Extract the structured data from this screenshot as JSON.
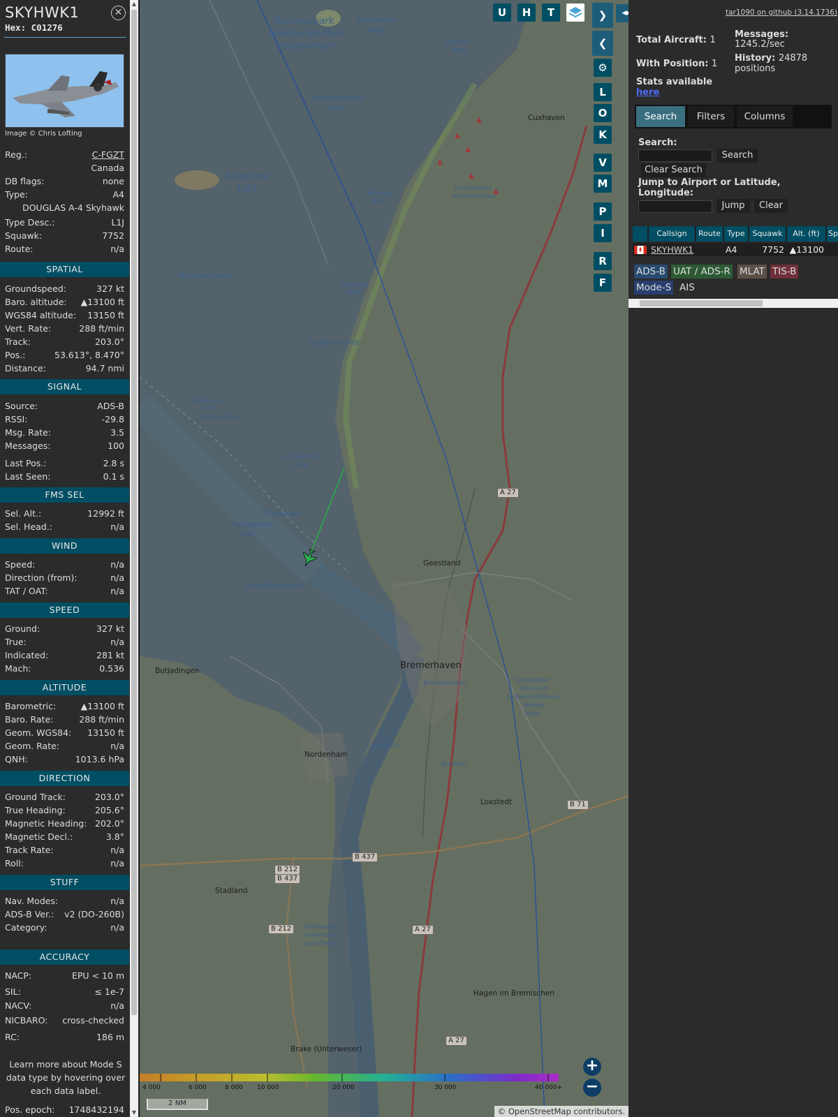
{
  "aircraft": {
    "callsign": "SKYHWK1",
    "hex_label": "Hex:",
    "hex": "C01276",
    "photo_credit": "Image © Chris Lofting",
    "reg_label": "Reg.:",
    "reg": "C-FGZT",
    "country": "Canada",
    "dbflags_label": "DB flags:",
    "dbflags": "none",
    "type_label": "Type:",
    "type": "A4",
    "type_full": "DOUGLAS A-4 Skyhawk",
    "typedesc_label": "Type Desc.:",
    "typedesc": "L1J",
    "squawk_label": "Squawk:",
    "squawk": "7752",
    "route_label": "Route:",
    "route": "n/a"
  },
  "sections": {
    "spatial": {
      "title": "SPATIAL",
      "rows": [
        {
          "k": "Groundspeed:",
          "v": "327 kt"
        },
        {
          "k": "Baro. altitude:",
          "v": "▲13100 ft"
        },
        {
          "k": "WGS84 altitude:",
          "v": "13150 ft"
        },
        {
          "k": "Vert. Rate:",
          "v": "288 ft/min"
        },
        {
          "k": "Track:",
          "v": "203.0°"
        },
        {
          "k": "Pos.:",
          "v": "53.613°, 8.470°"
        },
        {
          "k": "Distance:",
          "v": "94.7 nmi"
        }
      ]
    },
    "signal": {
      "title": "SIGNAL",
      "rows": [
        {
          "k": "Source:",
          "v": "ADS-B"
        },
        {
          "k": "RSSI:",
          "v": "-29.8"
        },
        {
          "k": "Msg. Rate:",
          "v": "3.5"
        },
        {
          "k": "Messages:",
          "v": "100"
        },
        {
          "k": "Last Pos.:",
          "v": "2.8 s"
        },
        {
          "k": "Last Seen:",
          "v": "0.1 s"
        }
      ]
    },
    "fms": {
      "title": "FMS SEL",
      "rows": [
        {
          "k": "Sel. Alt.:",
          "v": "12992 ft"
        },
        {
          "k": "Sel. Head.:",
          "v": "n/a"
        }
      ]
    },
    "wind": {
      "title": "WIND",
      "rows": [
        {
          "k": "Speed:",
          "v": "n/a"
        },
        {
          "k": "Direction (from):",
          "v": "n/a"
        },
        {
          "k": "TAT / OAT:",
          "v": "n/a"
        }
      ]
    },
    "speed": {
      "title": "SPEED",
      "rows": [
        {
          "k": "Ground:",
          "v": "327 kt"
        },
        {
          "k": "True:",
          "v": "n/a"
        },
        {
          "k": "Indicated:",
          "v": "281 kt"
        },
        {
          "k": "Mach:",
          "v": "0.536"
        }
      ]
    },
    "altitude": {
      "title": "ALTITUDE",
      "rows": [
        {
          "k": "Barometric:",
          "v": "▲13100 ft"
        },
        {
          "k": "Baro. Rate:",
          "v": "288 ft/min"
        },
        {
          "k": "Geom. WGS84:",
          "v": "13150 ft"
        },
        {
          "k": "Geom. Rate:",
          "v": "n/a"
        },
        {
          "k": "QNH:",
          "v": "1013.6 hPa"
        }
      ]
    },
    "direction": {
      "title": "DIRECTION",
      "rows": [
        {
          "k": "Ground Track:",
          "v": "203.0°"
        },
        {
          "k": "True Heading:",
          "v": "205.6°"
        },
        {
          "k": "Magnetic Heading:",
          "v": "202.0°"
        },
        {
          "k": "Magnetic Decl.:",
          "v": "3.8°"
        },
        {
          "k": "Track Rate:",
          "v": "n/a"
        },
        {
          "k": "Roll:",
          "v": "n/a"
        }
      ]
    },
    "stuff": {
      "title": "STUFF",
      "rows": [
        {
          "k": "Nav. Modes:",
          "v": "n/a"
        },
        {
          "k": "ADS-B Ver.:",
          "v": "v2 (DO-260B)"
        },
        {
          "k": "Category:",
          "v": "n/a"
        }
      ]
    },
    "accuracy": {
      "title": "ACCURACY",
      "rows": [
        {
          "k": "NACP:",
          "v": "EPU < 10 m"
        },
        {
          "k": "SIL:",
          "v": "≤ 1e-7"
        },
        {
          "k": "NACV:",
          "v": "n/a"
        },
        {
          "k": "NICBARO:",
          "v": "cross-checked"
        },
        {
          "k": "RC:",
          "v": "186 m"
        }
      ]
    }
  },
  "note": "Learn more about Mode S data type by hovering over each data label.",
  "epoch_label": "Pos. epoch:",
  "epoch": "1748432194",
  "map": {
    "buttons": [
      "U",
      "H",
      "T"
    ],
    "side_buttons": [
      "L",
      "O",
      "K",
      "V",
      "M",
      "P",
      "I",
      "R",
      "F"
    ],
    "labels": [
      {
        "t": "Nationalpark",
        "cls": "water"
      },
      {
        "t": "Hamburgisches",
        "cls": "water"
      },
      {
        "t": "Wattenmeer",
        "cls": "water"
      },
      {
        "t": "Neuwerker",
        "cls": "water"
      },
      {
        "t": "Watt",
        "cls": "water"
      },
      {
        "t": "Duhner",
        "cls": "water"
      },
      {
        "t": "Watt",
        "cls": "water"
      },
      {
        "t": "Sahlenburger",
        "cls": "water"
      },
      {
        "t": "Watt",
        "cls": "water"
      },
      {
        "t": "Ruhezone",
        "cls": "water"
      },
      {
        "t": "1/47",
        "cls": "water"
      },
      {
        "t": "Nordeversand",
        "cls": "water"
      },
      {
        "t": "Wurster",
        "cls": "water"
      },
      {
        "t": "Watt",
        "cls": "water"
      },
      {
        "t": "Wurster",
        "cls": "water"
      },
      {
        "t": "Watt",
        "cls": "water"
      },
      {
        "t": "Sudeversand",
        "cls": "water"
      },
      {
        "t": "Ruhezone",
        "cls": "water"
      },
      {
        "t": "1/46",
        "cls": "water"
      },
      {
        "t": "Robbenplate",
        "cls": "water"
      },
      {
        "t": "Ruhezone",
        "cls": "water"
      },
      {
        "t": "1/44",
        "cls": "water"
      },
      {
        "t": "Tideweser",
        "cls": "water"
      },
      {
        "t": "Ruhezone",
        "cls": "water"
      },
      {
        "t": "1/40",
        "cls": "water"
      },
      {
        "t": "Langlütjensand",
        "cls": "water"
      },
      {
        "t": "Cuxhaven",
        "cls": "town"
      },
      {
        "t": "Cuxhavener",
        "cls": "water"
      },
      {
        "t": "Küstenheiden",
        "cls": "water"
      },
      {
        "t": "Geestland",
        "cls": "town"
      },
      {
        "t": "Bremerhaven",
        "cls": "town"
      },
      {
        "t": "Bremerhaven",
        "cls": "water"
      },
      {
        "t": "Butjadingen",
        "cls": "town"
      },
      {
        "t": "Sellstedter",
        "cls": "water"
      },
      {
        "t": "See und",
        "cls": "water"
      },
      {
        "t": "Ochsentriftmoor/",
        "cls": "water"
      },
      {
        "t": "Wildes",
        "cls": "water"
      },
      {
        "t": "Moor",
        "cls": "water"
      },
      {
        "t": "Nordenham",
        "cls": "town"
      },
      {
        "t": "Luneplate",
        "cls": "water"
      },
      {
        "t": "Bremen",
        "cls": "water"
      },
      {
        "t": "Loxstedt",
        "cls": "town"
      },
      {
        "t": "Stadland",
        "cls": "town"
      },
      {
        "t": "Strohauser",
        "cls": "water"
      },
      {
        "t": "Vorländer",
        "cls": "water"
      },
      {
        "t": "und Plate",
        "cls": "water"
      },
      {
        "t": "Hagen im Bremischen",
        "cls": "town"
      },
      {
        "t": "Brake (Unterweser)",
        "cls": "town"
      }
    ],
    "road_shields": [
      "A 27",
      "B 437",
      "B 212",
      "B 437",
      "B 212",
      "A 27",
      "B 71",
      "A 27"
    ],
    "scale_ticks": [
      "4 000",
      "6 000",
      "8 000",
      "10 000",
      "20 000",
      "30 000",
      "40 000+"
    ],
    "scale_bar": "2 NM",
    "attribution": "© OpenStreetMap contributors."
  },
  "right": {
    "github_link": "tar1090 on github (3.14.1736)",
    "total_aircraft_label": "Total Aircraft:",
    "total_aircraft": "1",
    "with_position_label": "With Position:",
    "with_position": "1",
    "messages_label": "Messages:",
    "messages": "1245.2/sec",
    "history_label": "History:",
    "history": "24878 positions",
    "stats_label": "Stats available",
    "stats_link": "here",
    "tabs": [
      "Search",
      "Filters",
      "Columns"
    ],
    "search_label": "Search:",
    "search_button": "Search",
    "clear_search_button": "Clear Search",
    "jump_label": "Jump to Airport or Latitude, Longitude:",
    "jump_button": "Jump",
    "clear_button": "Clear",
    "columns": [
      "Callsign",
      "Route",
      "Type",
      "Squawk",
      "Alt. (ft)",
      "Sp"
    ],
    "rows": [
      {
        "callsign": "SKYHWK1",
        "route": "",
        "type": "A4",
        "squawk": "7752",
        "alt": "▲13100"
      }
    ],
    "legend": [
      {
        "t": "ADS-B",
        "bg": "#284a70"
      },
      {
        "t": "UAT / ADS-R",
        "bg": "#2d5a35"
      },
      {
        "t": "MLAT",
        "bg": "#5a5047"
      },
      {
        "t": "TIS-B",
        "bg": "#6e2f38"
      },
      {
        "t": "Mode-S",
        "bg": "#283e6e"
      },
      {
        "t": "AIS",
        "bg": "#2b2b2b"
      }
    ]
  }
}
